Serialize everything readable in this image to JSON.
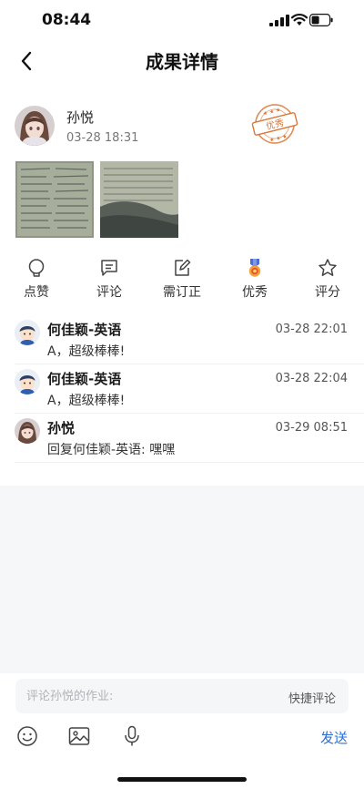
{
  "status_bar": {
    "time": "08:44"
  },
  "nav": {
    "title": "成果详情",
    "back_icon": "chevron-left-icon"
  },
  "author": {
    "name": "孙悦",
    "time": "03-28 18:31",
    "stamp_text": "优秀"
  },
  "actions": [
    {
      "label": "点赞",
      "icon": "like-bubble-icon"
    },
    {
      "label": "评论",
      "icon": "comment-icon"
    },
    {
      "label": "需订正",
      "icon": "edit-icon"
    },
    {
      "label": "优秀",
      "icon": "medal-icon"
    },
    {
      "label": "评分",
      "icon": "star-icon"
    }
  ],
  "comments": [
    {
      "name": "何佳颖-英语",
      "time": "03-28 22:01",
      "text": "A，超级棒棒!"
    },
    {
      "name": "何佳颖-英语",
      "time": "03-28 22:04",
      "text": "A，超级棒棒!"
    },
    {
      "name": "孙悦",
      "time": "03-29 08:51",
      "text": "回复何佳颖-英语: 嘿嘿"
    }
  ],
  "composer": {
    "placeholder": "评论孙悦的作业:",
    "quick_label": "快捷评论",
    "send_label": "发送"
  },
  "colors": {
    "accent": "#2b6fd6",
    "stamp": "#d9783a"
  }
}
